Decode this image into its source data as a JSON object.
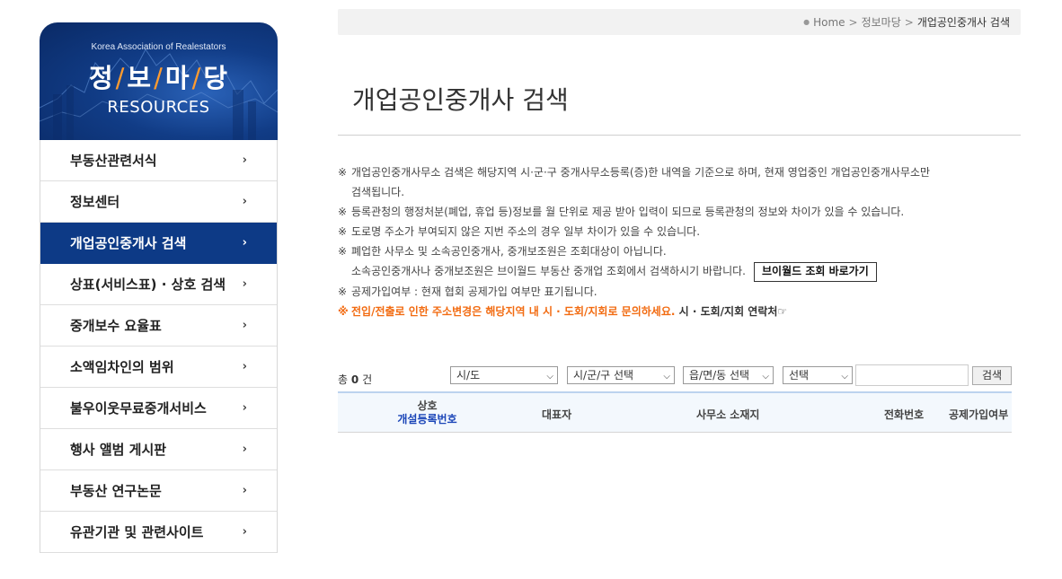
{
  "sidebar": {
    "banner": {
      "org": "Korea Association of Realestators",
      "title_chars": [
        "정",
        "보",
        "마",
        "당"
      ],
      "separator": "/",
      "title_en": "RESOURCES"
    },
    "items": [
      {
        "label": "부동산관련서식"
      },
      {
        "label": "정보센터"
      },
      {
        "label": "개업공인중개사 검색"
      },
      {
        "label": "상표(서비스표) · 상호 검색"
      },
      {
        "label": "중개보수 요율표"
      },
      {
        "label": "소액임차인의 범위"
      },
      {
        "label": "불우이웃무료중개서비스"
      },
      {
        "label": "행사 앨범 게시판"
      },
      {
        "label": "부동산 연구논문"
      },
      {
        "label": "유관기관 및 관련사이트"
      }
    ],
    "active_index": 2,
    "chevron": "›"
  },
  "breadcrumb": {
    "home": "Home",
    "sep": ">",
    "parent": "정보마당",
    "current": "개업공인중개사 검색"
  },
  "page": {
    "title": "개업공인중개사 검색"
  },
  "notices": {
    "mark": "※",
    "n1_line1": "개업공인중개사무소 검색은 해당지역 시·군·구 중개사무소등록(증)한 내역을 기준으로 하며, 현재 영업중인 개업공인중개사무소만",
    "n1_line2": "검색됩니다.",
    "n2": "등록관청의 행정처분(폐업, 휴업 등)정보를 월 단위로 제공 받아 입력이 되므로 등록관청의 정보와 차이가 있을 수 있습니다.",
    "n3": "도로명 주소가 부여되지 않은 지번 주소의 경우 일부 차이가 있을 수 있습니다.",
    "n4_line1": "폐업한 사무소 및 소속공인중개사, 중개보조원은 조회대상이 아닙니다.",
    "n4_line2": "소속공인중개사나 중개보조원은 브이월드 부동산 중개업 조회에서 검색하시기 바랍니다.",
    "vworld_button": "브이월드 조회 바로가기",
    "n5": "공제가입여부 : 현재 협회 공제가입 여부만 표기됩니다.",
    "n6_orange": "전입/전출로 인한 주소변경은 해당지역 내 시 · 도회/지회로 문의하세요.",
    "n6_link": "시 · 도회/지회 연락처☞"
  },
  "search": {
    "count_prefix": "총",
    "count": "0",
    "count_suffix": "건",
    "sido": "시/도",
    "sigungu": "시/군/구 선택",
    "eupmyeondong": "읍/면/동 선택",
    "category": "선택",
    "keyword": "",
    "button": "검색"
  },
  "table": {
    "col_name_line1": "상호",
    "col_name_line2": "개설등록번호",
    "col_rep": "대표자",
    "col_addr": "사무소 소재지",
    "col_tel": "전화번호",
    "col_ins": "공제가입여부"
  }
}
